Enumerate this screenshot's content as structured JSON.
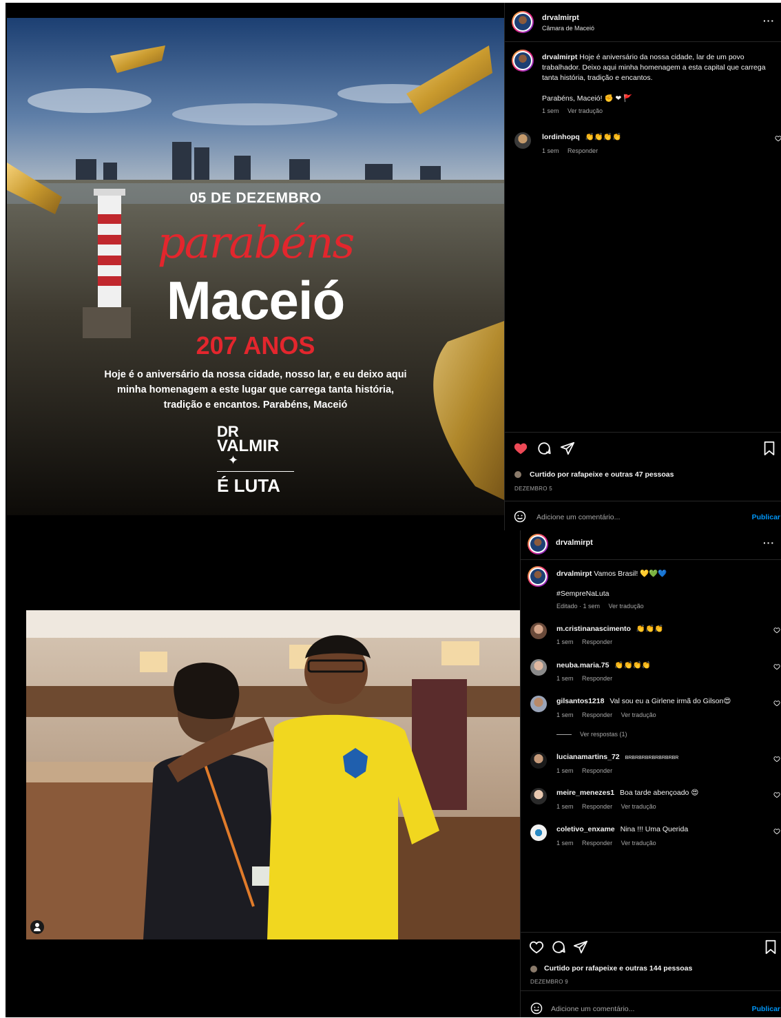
{
  "post1": {
    "username": "drvalmirpt",
    "location": "Câmara de Maceió",
    "more": "···",
    "poster": {
      "date_line": "05 DE DEZEMBRO",
      "script_word": "parabéns",
      "city": "Maceió",
      "years": "207 ANOS",
      "message_1": "Hoje é o aniversário da nossa cidade, nosso lar, e eu deixo aqui",
      "message_2": "minha homenagem a este lugar que carrega tanta história,",
      "message_3": "tradição e encantos. Parabéns, Maceió",
      "logo_line1": "DR",
      "logo_line2": "VALMIR",
      "logo_line3": "É LUTA"
    },
    "caption": {
      "username": "drvalmirpt",
      "text": "Hoje é aniversário da nossa cidade, lar de um povo trabalhador. Deixo aqui minha homenagem a esta capital que carrega tanta história, tradição e encantos.",
      "line2": "Parabéns, Maceió! ✊ ❤ 🚩",
      "time": "1 sem",
      "translate": "Ver tradução"
    },
    "comments": [
      {
        "username": "lordinhopq",
        "text": "👏👏👏👏",
        "time": "1 sem",
        "reply": "Responder"
      }
    ],
    "likes": "Curtido por rafapeixe e outras 47 pessoas",
    "date": "DEZEMBRO 5",
    "add_comment_placeholder": "Adicione um comentário...",
    "publish": "Publicar",
    "colors": {
      "like": "#ed4956",
      "link": "#0095f6"
    }
  },
  "post2": {
    "username": "drvalmirpt",
    "more": "···",
    "caption": {
      "username": "drvalmirpt",
      "text": "Vamos Brasil! 💛💚💙",
      "hashtag": "#SempreNaLuta",
      "edited": "Editado · 1 sem",
      "translate": "Ver tradução"
    },
    "comments": [
      {
        "username": "m.cristinanascimento",
        "text": "👏👏👏",
        "time": "1 sem",
        "reply": "Responder",
        "translate": ""
      },
      {
        "username": "neuba.maria.75",
        "text": "👏👏👏👏",
        "time": "1 sem",
        "reply": "Responder",
        "translate": ""
      },
      {
        "username": "gilsantos1218",
        "text": "Val sou eu a Girlene irmã do Gilson😍",
        "time": "1 sem",
        "reply": "Responder",
        "translate": "Ver tradução"
      },
      {
        "username": "lucianamartins_72",
        "text": "BRBRBRBRBRBRBRBR",
        "time": "1 sem",
        "reply": "Responder",
        "translate": ""
      },
      {
        "username": "meire_menezes1",
        "text": "Boa tarde abençoado 😍",
        "time": "1 sem",
        "reply": "Responder",
        "translate": "Ver tradução"
      },
      {
        "username": "coletivo_enxame",
        "text": "Nina !!! Uma Querida",
        "time": "1 sem",
        "reply": "Responder",
        "translate": "Ver tradução"
      }
    ],
    "view_replies": "Ver respostas (1)",
    "likes": "Curtido por rafapeixe e outras 144 pessoas",
    "date": "DEZEMBRO 9",
    "add_comment_placeholder": "Adicione um comentário...",
    "publish": "Publicar"
  }
}
